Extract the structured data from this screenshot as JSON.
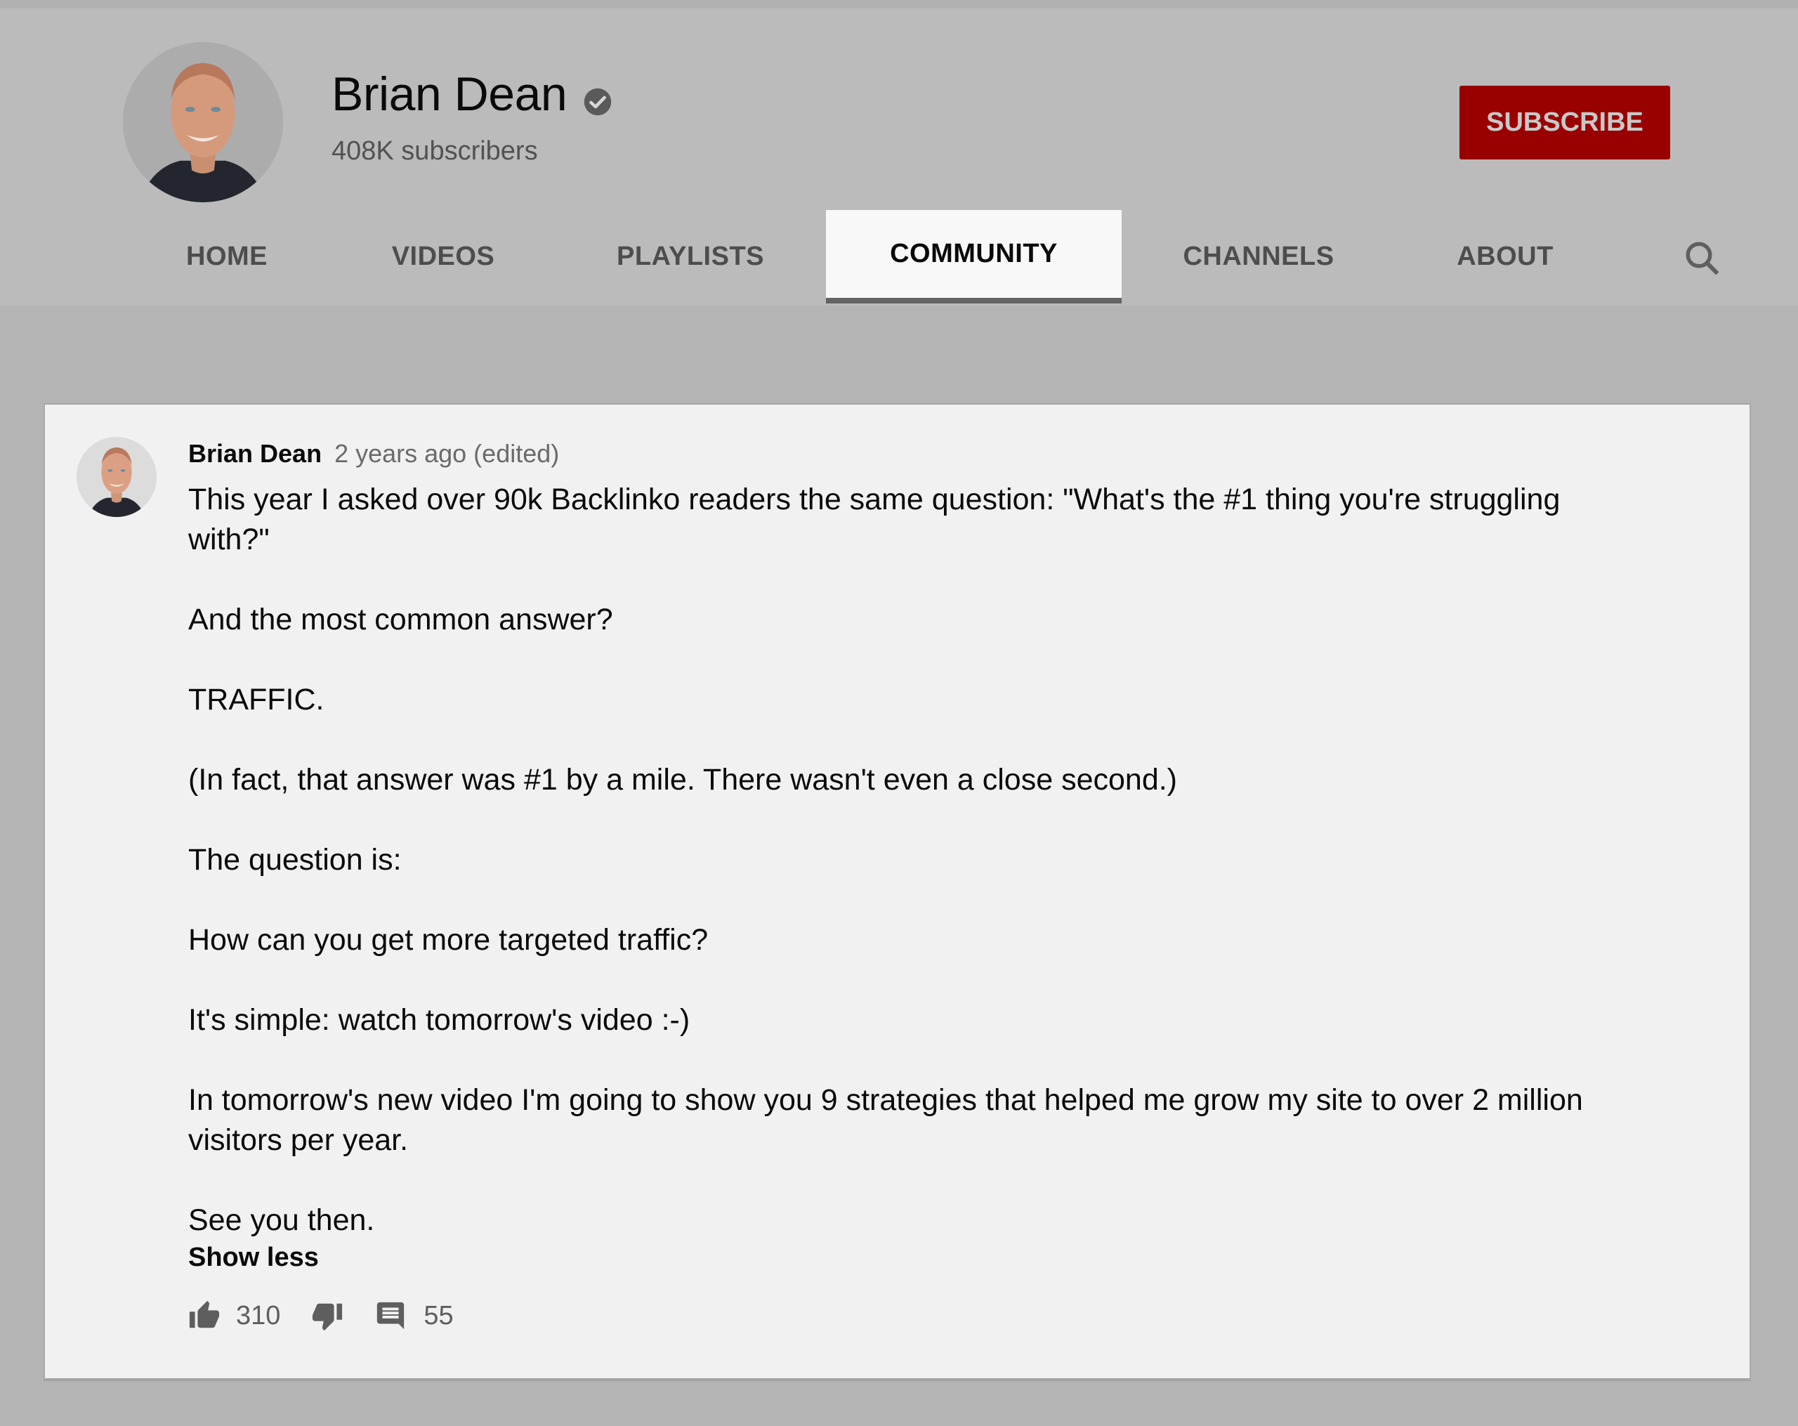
{
  "channel": {
    "name": "Brian Dean",
    "verified": true,
    "subscribers": "408K subscribers",
    "subscribe_label": "SUBSCRIBE",
    "brand_color": "#990000"
  },
  "tabs": [
    {
      "label": "HOME",
      "active": false
    },
    {
      "label": "VIDEOS",
      "active": false
    },
    {
      "label": "PLAYLISTS",
      "active": false
    },
    {
      "label": "COMMUNITY",
      "active": true
    },
    {
      "label": "CHANNELS",
      "active": false
    },
    {
      "label": "ABOUT",
      "active": false
    }
  ],
  "icons": {
    "search": "search-icon",
    "verified": "verified-check-icon",
    "like": "thumbs-up-icon",
    "dislike": "thumbs-down-icon",
    "comment": "comment-icon"
  },
  "post": {
    "author": "Brian Dean",
    "time": "2 years ago (edited)",
    "paragraphs": [
      "This year I asked over 90k Backlinko readers the same question:  \"What's the #1 thing you're struggling with?\"",
      "And the most common answer?",
      "TRAFFIC.",
      "(In fact, that answer was #1 by a mile. There wasn't even a close second.)",
      "The question is:",
      "How can you get more targeted traffic?",
      "It's simple: watch tomorrow's video :-)",
      "In tomorrow's new video I'm going to show you 9 strategies that helped me grow my site to over 2 million visitors per year.",
      "See you then."
    ],
    "show_less_label": "Show less",
    "likes": "310",
    "comments": "55"
  }
}
